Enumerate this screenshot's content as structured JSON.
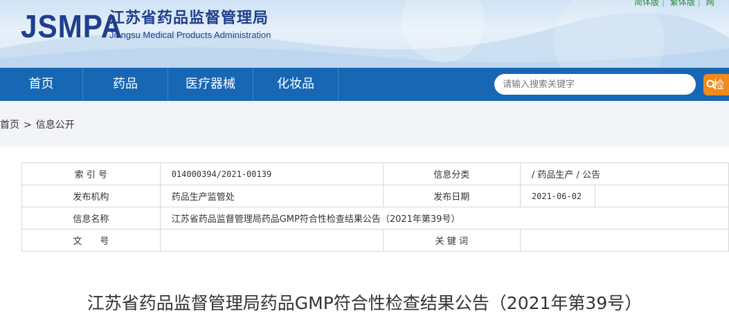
{
  "header": {
    "logo_text": "JSMPA",
    "org_name_cn": "江苏省药品监督管理局",
    "org_name_en": "Jiangsu Medical Products Administration",
    "top_links": [
      "简体版",
      "繁体版",
      "网"
    ]
  },
  "nav": {
    "items": [
      {
        "label": "首页"
      },
      {
        "label": "药品"
      },
      {
        "label": "医疗器械"
      },
      {
        "label": "化妆品"
      }
    ],
    "search_placeholder": "请输入搜索关键字",
    "search_button": "检"
  },
  "breadcrumb": {
    "home": "首页",
    "arrow": ">",
    "current": "信息公开"
  },
  "info_table": {
    "index_label": "索 引 号",
    "index_value": "014000394/2021-00139",
    "category_label": "信息分类",
    "category_value": "/ 药品生产 / 公告",
    "publisher_label": "发布机构",
    "publisher_value": "药品生产监管处",
    "date_label": "发布日期",
    "date_value": "2021-06-02",
    "name_label": "信息名称",
    "name_value": "江苏省药品监督管理局药品GMP符合性检查结果公告（2021年第39号）",
    "docno_label": "文　　号",
    "docno_value": "",
    "keywords_label": "关 键 词",
    "keywords_value": ""
  },
  "document": {
    "title": "江苏省药品监督管理局药品GMP符合性检查结果公告（2021年第39号）"
  },
  "colors": {
    "nav_blue": "#1767b5",
    "logo_blue": "#1f3f8c",
    "search_orange": "#f28a1c",
    "link_green": "#2a8b3b"
  }
}
